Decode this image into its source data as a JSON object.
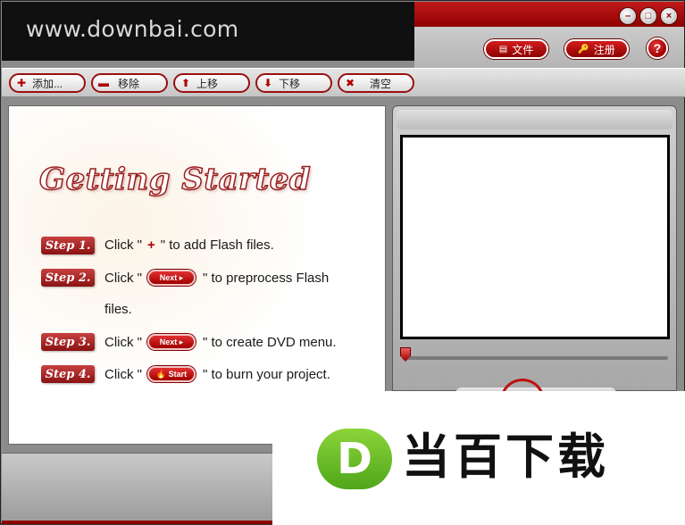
{
  "header": {
    "brand": "www.downbai.com",
    "window_controls": {
      "minimize": "–",
      "maximize": "□",
      "close": "×"
    },
    "file_button": {
      "icon": "list-icon",
      "label": "文件"
    },
    "register_button": {
      "icon": "key-icon",
      "label": "注册"
    },
    "help_button": {
      "label": "?"
    }
  },
  "toolbar": {
    "add": {
      "icon": "plus-icon",
      "label": "添加..."
    },
    "remove": {
      "icon": "minus-icon",
      "label": "移除"
    },
    "move_up": {
      "icon": "arrow-up-icon",
      "label": "上移"
    },
    "move_down": {
      "icon": "arrow-down-icon",
      "label": "下移"
    },
    "clear": {
      "icon": "x-icon",
      "label": "清空"
    }
  },
  "getting_started": {
    "title": "Getting Started",
    "steps": [
      {
        "badge": "Step 1.",
        "before": "Click \"",
        "button": "+",
        "after": "\" to add Flash files."
      },
      {
        "badge": "Step 2.",
        "before": "Click \"",
        "button": "Next ▸",
        "after": "\" to preprocess Flash"
      },
      {
        "continuation": "files."
      },
      {
        "badge": "Step 3.",
        "before": "Click \"",
        "button": "Next ▸",
        "after": "\" to create DVD menu."
      },
      {
        "badge": "Step 4.",
        "before": "Click \"",
        "button": "🔥 Start",
        "after": "\" to burn your project."
      }
    ]
  },
  "watermark": {
    "logo_letter": "D",
    "text": "当百下载"
  },
  "colors": {
    "accent_red": "#a00000",
    "header_dark": "#101010",
    "watermark_green": "#6cbf2a"
  }
}
